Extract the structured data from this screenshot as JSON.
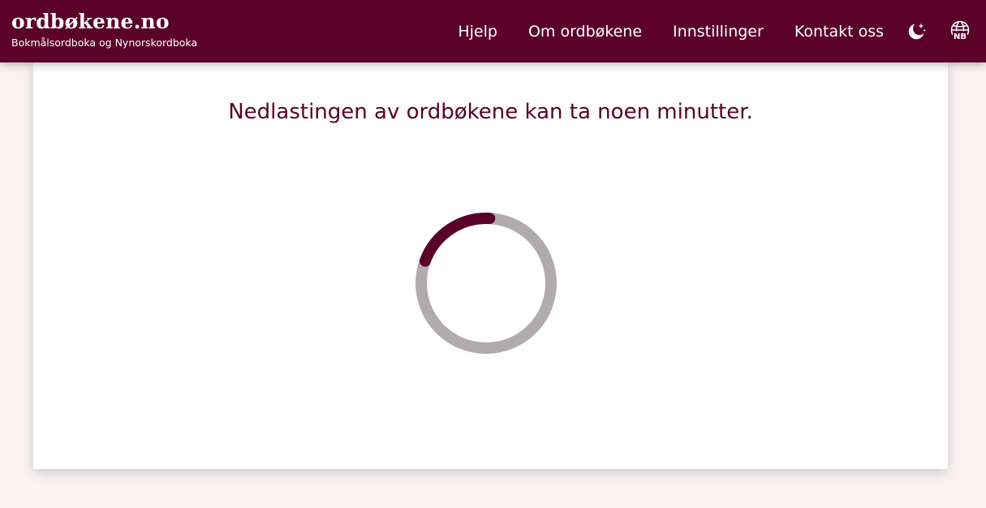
{
  "header": {
    "title": "ordbøkene.no",
    "subtitle": "Bokmålsordboka og Nynorskordboka",
    "nav": {
      "help": "Hjelp",
      "about": "Om ordbøkene",
      "settings": "Innstillinger",
      "contact": "Kontakt oss"
    },
    "icons": {
      "theme": "moon-stars-icon",
      "language": "globe-icon"
    },
    "language_code": "NB",
    "colors": {
      "brand": "#5a0029",
      "text": "#ffffff"
    }
  },
  "main": {
    "loading_message": "Nedlastingen av ordbøkene kan ta noen minutter.",
    "spinner": {
      "track_color": "#b0acab",
      "arc_color": "#5a0029"
    }
  },
  "colors": {
    "page_background": "#fbf3f3",
    "card_background": "#ffffff"
  }
}
